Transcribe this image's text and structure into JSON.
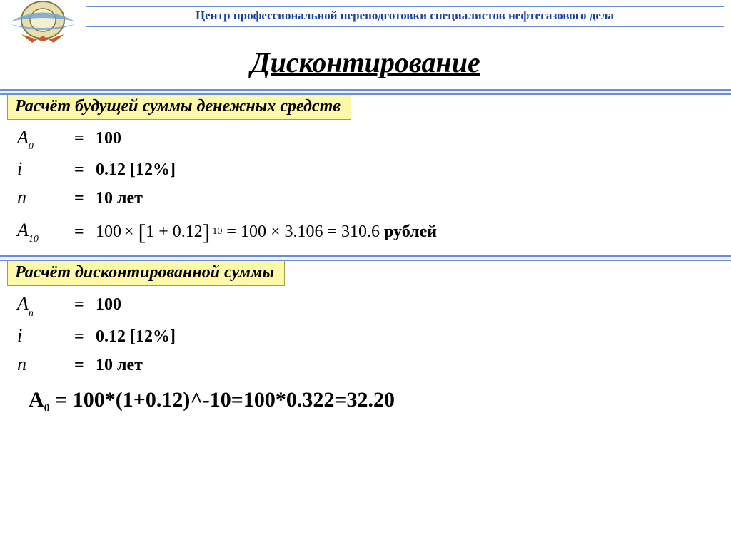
{
  "header": {
    "org": "Центр профессиональной переподготовки специалистов нефтегазового дела"
  },
  "title": "Дисконтирование",
  "section1": {
    "label": "Расчёт будущей суммы денежных средств",
    "a0_var": "A",
    "a0_sub": "0",
    "a0_val": "100",
    "i_var": "i",
    "i_val": "0.12 [12%]",
    "n_var": "n",
    "n_val": "10 лет",
    "a10_var": "A",
    "a10_sub": "10",
    "formula_lead": "100",
    "formula_inner": "1 + 0.12",
    "formula_exp": "10",
    "formula_mid": "= 100 × 3.106 = 310.6",
    "rubles": "рублей"
  },
  "section2": {
    "label": "Расчёт дисконтированной суммы",
    "an_var": "A",
    "an_sub": "n",
    "an_val": "100",
    "i_var": "i",
    "i_val": "0.12 [12%]",
    "n_var": "n",
    "n_val": "10 лет",
    "final_var": "A",
    "final_sub": "0",
    "final_expr": " = 100*(1+0.12)^-10=100*0.322=32.20"
  },
  "eq": "="
}
